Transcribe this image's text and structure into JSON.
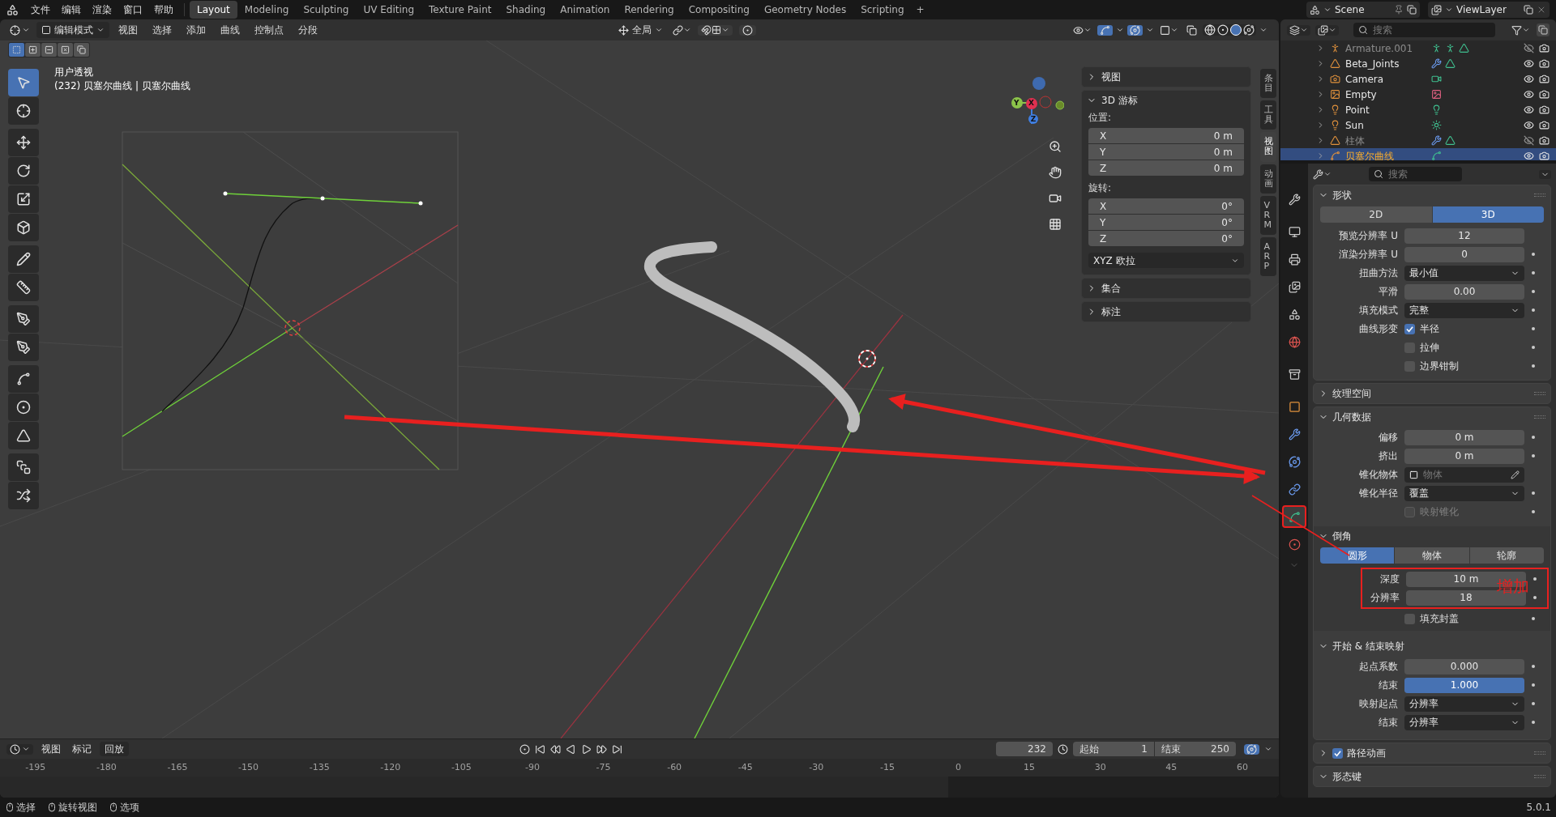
{
  "top_menu": [
    "文件",
    "编辑",
    "渲染",
    "窗口",
    "帮助"
  ],
  "workspaces": [
    {
      "label": "Layout",
      "selected": true
    },
    {
      "label": "Modeling",
      "selected": false
    },
    {
      "label": "Sculpting",
      "selected": false
    },
    {
      "label": "UV Editing",
      "selected": false
    },
    {
      "label": "Texture Paint",
      "selected": false
    },
    {
      "label": "Shading",
      "selected": false
    },
    {
      "label": "Animation",
      "selected": false
    },
    {
      "label": "Rendering",
      "selected": false
    },
    {
      "label": "Compositing",
      "selected": false
    },
    {
      "label": "Geometry Nodes",
      "selected": false
    },
    {
      "label": "Scripting",
      "selected": false
    }
  ],
  "add_workspace": "+",
  "scene": "Scene",
  "view_layer": "ViewLayer",
  "viewport": {
    "mode": "编辑模式",
    "menus": [
      "视图",
      "选择",
      "添加",
      "曲线",
      "控制点",
      "分段"
    ],
    "orientation": "全局",
    "view_name": "用户透视",
    "object_info": "(232) 贝塞尔曲线 | 贝塞尔曲线",
    "selection_modes": [
      {
        "kind": "set",
        "selected": true
      },
      {
        "kind": "extend",
        "selected": false
      },
      {
        "kind": "subtract",
        "selected": false
      },
      {
        "kind": "invert",
        "selected": false
      },
      {
        "kind": "intersect",
        "selected": false
      }
    ],
    "tools": [
      {
        "kind": "select",
        "selected": true
      },
      {
        "kind": "cursor",
        "selected": false
      },
      {
        "kind": "move",
        "selected": false
      },
      {
        "kind": "rotate",
        "selected": false
      },
      {
        "kind": "scale",
        "selected": false
      },
      {
        "kind": "transform",
        "selected": false
      },
      {
        "kind": "annotate",
        "selected": false
      },
      {
        "kind": "measure",
        "selected": false
      },
      {
        "kind": "draw",
        "selected": false
      },
      {
        "kind": "pen",
        "selected": false
      },
      {
        "kind": "curve",
        "selected": false
      },
      {
        "kind": "radius",
        "selected": false
      },
      {
        "kind": "tilt",
        "selected": false
      },
      {
        "kind": "extrude",
        "selected": false
      },
      {
        "kind": "randomize",
        "selected": false
      }
    ],
    "gizmo_axes": [
      "X",
      "Y",
      "Z"
    ]
  },
  "sidebar": {
    "panels": [
      {
        "title": "视图",
        "expanded": false
      },
      {
        "title": "3D 游标",
        "expanded": true
      },
      {
        "title": "集合",
        "expanded": false
      },
      {
        "title": "标注",
        "expanded": false
      }
    ],
    "location_label": "位置:",
    "location": [
      {
        "axis": "X",
        "value": "0 m"
      },
      {
        "axis": "Y",
        "value": "0 m"
      },
      {
        "axis": "Z",
        "value": "0 m"
      }
    ],
    "rotation_label": "旋转:",
    "rotation": [
      {
        "axis": "X",
        "value": "0°"
      },
      {
        "axis": "Y",
        "value": "0°"
      },
      {
        "axis": "Z",
        "value": "0°"
      }
    ],
    "rotation_mode": "XYZ 欧拉",
    "tabs": [
      {
        "label": "条目",
        "selected": false
      },
      {
        "label": "工具",
        "selected": false
      },
      {
        "label": "视图",
        "selected": true
      },
      {
        "label": "动画",
        "selected": false
      },
      {
        "label": "VRM",
        "selected": false
      },
      {
        "label": "ARP",
        "selected": false
      }
    ]
  },
  "outliner": {
    "search_placeholder": "搜索",
    "items": [
      {
        "name": "Armature.001",
        "kind": "armature",
        "dimmed": true,
        "visible": false,
        "selected": false
      },
      {
        "name": "Beta_Joints",
        "kind": "mesh",
        "dimmed": false,
        "visible": true,
        "selected": false
      },
      {
        "name": "Camera",
        "kind": "camera",
        "dimmed": false,
        "visible": true,
        "selected": false
      },
      {
        "name": "Empty",
        "kind": "empty",
        "dimmed": false,
        "visible": true,
        "selected": false
      },
      {
        "name": "Point",
        "kind": "light",
        "dimmed": false,
        "visible": true,
        "selected": false
      },
      {
        "name": "Sun",
        "kind": "sun",
        "dimmed": false,
        "visible": true,
        "selected": false
      },
      {
        "name": "柱体",
        "kind": "mesh",
        "dimmed": true,
        "visible": false,
        "selected": false
      },
      {
        "name": "贝塞尔曲线",
        "kind": "curve",
        "dimmed": false,
        "visible": true,
        "selected": true
      }
    ]
  },
  "properties": {
    "search_placeholder": "搜索",
    "tabs": [
      {
        "kind": "tool",
        "selected": false,
        "highlighted": false
      },
      {
        "kind": "render",
        "selected": false,
        "highlighted": false
      },
      {
        "kind": "output",
        "selected": false,
        "highlighted": false
      },
      {
        "kind": "view_layer",
        "selected": false,
        "highlighted": false
      },
      {
        "kind": "scene",
        "selected": false,
        "highlighted": false
      },
      {
        "kind": "world",
        "selected": false,
        "highlighted": false
      },
      {
        "kind": "collection",
        "selected": false,
        "highlighted": false
      },
      {
        "kind": "object",
        "selected": false,
        "highlighted": false
      },
      {
        "kind": "modifiers",
        "selected": false,
        "highlighted": false
      },
      {
        "kind": "physics",
        "selected": false,
        "highlighted": false
      },
      {
        "kind": "constraints",
        "selected": false,
        "highlighted": false
      },
      {
        "kind": "data",
        "selected": true,
        "highlighted": true
      },
      {
        "kind": "material",
        "selected": false,
        "highlighted": false
      }
    ],
    "sections": [
      {
        "title": "形状",
        "kind": "plain",
        "expanded": true,
        "rows": [
          {
            "kind": "toggle",
            "options": [
              {
                "label": "2D",
                "selected": false
              },
              {
                "label": "3D",
                "selected": true
              }
            ]
          },
          {
            "kind": "number",
            "label": "预览分辨率 U",
            "value": "12",
            "animatable": false
          },
          {
            "kind": "number",
            "label": "渲染分辨率 U",
            "value": "0",
            "animatable": true
          },
          {
            "kind": "dropdown",
            "label": "扭曲方法",
            "value": "最小值",
            "animatable": true
          },
          {
            "kind": "number",
            "label": "平滑",
            "value": "0.00",
            "animatable": true
          },
          {
            "kind": "dropdown",
            "label": "填充模式",
            "value": "完整",
            "animatable": true
          },
          {
            "kind": "checkbox",
            "label": "曲线形变",
            "text": "半径",
            "checked": true,
            "disabled": false,
            "animatable": true
          },
          {
            "kind": "checkbox",
            "text": "拉伸",
            "checked": false,
            "disabled": false,
            "animatable": true
          },
          {
            "kind": "checkbox",
            "text": "边界钳制",
            "checked": false,
            "disabled": false,
            "animatable": true
          }
        ]
      },
      {
        "title": "纹理空间",
        "kind": "plain",
        "expanded": false
      },
      {
        "title": "几何数据",
        "kind": "plain",
        "expanded": true,
        "rows": [
          {
            "kind": "number",
            "label": "偏移",
            "value": "0 m",
            "animatable": true
          },
          {
            "kind": "number",
            "label": "挤出",
            "value": "0 m",
            "animatable": true
          },
          {
            "kind": "object",
            "label": "锥化物体",
            "placeholder": "物体",
            "animatable": false
          },
          {
            "kind": "dropdown",
            "label": "锥化半径",
            "value": "覆盖",
            "animatable": true
          },
          {
            "kind": "checkbox",
            "text": "映射锥化",
            "checked": false,
            "disabled": true,
            "animatable": true
          }
        ],
        "children": [
          {
            "title": "倒角",
            "expanded": true,
            "rows": [
              {
                "kind": "toggle",
                "options": [
                  {
                    "label": "圆形",
                    "selected": true
                  },
                  {
                    "label": "物体",
                    "selected": false
                  },
                  {
                    "label": "轮廓",
                    "selected": false
                  }
                ]
              },
              {
                "kind": "number",
                "label": "深度",
                "value": "10 m",
                "animatable": true,
                "highlighted": true
              },
              {
                "kind": "number",
                "label": "分辨率",
                "value": "18",
                "animatable": true,
                "highlighted": true
              },
              {
                "kind": "checkbox",
                "text": "填充封盖",
                "checked": false,
                "disabled": false,
                "animatable": true,
                "highlighted": false
              }
            ]
          },
          {
            "title": "开始 & 结束映射",
            "expanded": true,
            "rows": [
              {
                "kind": "number",
                "label": "起点系数",
                "value": "0.000",
                "animatable": true
              },
              {
                "kind": "slider",
                "label": "结束",
                "value": "1.000",
                "level": 1,
                "animatable": true
              },
              {
                "kind": "dropdown",
                "label": "映射起点",
                "value": "分辨率",
                "animatable": true
              },
              {
                "kind": "dropdown",
                "label": "结束",
                "value": "分辨率",
                "animatable": true
              }
            ]
          }
        ]
      },
      {
        "title": "路径动画",
        "kind": "checkable",
        "checked": true,
        "expanded": false
      },
      {
        "title": "形态键",
        "kind": "plain",
        "expanded": true
      }
    ]
  },
  "annotation": {
    "note": "增加"
  },
  "timeline": {
    "menus": [
      "视图",
      "标记",
      "回放"
    ],
    "current_frame": "232",
    "start_label": "起始",
    "start": "1",
    "end_label": "结束",
    "end": "250",
    "ticks": [
      "-195",
      "-180",
      "-165",
      "-150",
      "-135",
      "-120",
      "-105",
      "-90",
      "-75",
      "-60",
      "-45",
      "-30",
      "-15",
      "0",
      "15",
      "30",
      "45",
      "60"
    ]
  },
  "status_bar": {
    "hints": [
      "选择",
      "旋转视图",
      "选项"
    ],
    "version": "5.0.1"
  }
}
